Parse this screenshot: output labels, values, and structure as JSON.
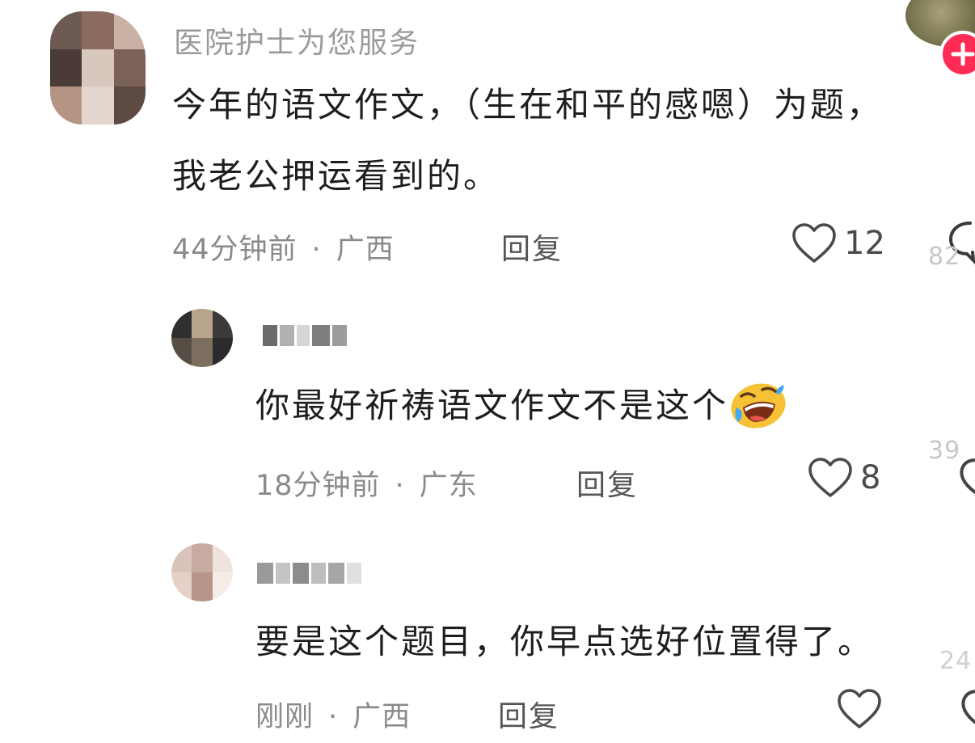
{
  "comments": [
    {
      "username": "医院护士为您服务",
      "lines": [
        "今年的语文作文，（生在和平的感嗯）为题，",
        "我老公押运看到的。"
      ],
      "time": "44分钟前",
      "separator": "·",
      "region": "广西",
      "reply_label": "回复",
      "likes": "12",
      "avatar_colors": [
        "#6d5a52",
        "#8b6b5e",
        "#c9b1a5",
        "#4a3b36",
        "#d8c7bd",
        "#7a6257",
        "#b59484",
        "#e2d6ce",
        "#5c4a43"
      ]
    },
    {
      "username": "",
      "text": "你最好祈祷语文作文不是这个",
      "emoji": "rolling-on-floor-laughing-emoji",
      "time": "18分钟前",
      "separator": "·",
      "region": "广东",
      "reply_label": "回复",
      "likes": "8",
      "avatar_colors": [
        "#2f2f2f",
        "#b8a58c",
        "#3a3a3a",
        "#564e45",
        "#7d6f5f",
        "#2b2b2b"
      ]
    },
    {
      "username": "",
      "text": "要是这个题目，你早点选好位置得了。",
      "time": "刚刚",
      "separator": "·",
      "region": "广西",
      "reply_label": "回复",
      "likes": "",
      "avatar_colors": [
        "#d9c4bc",
        "#c7aaa0",
        "#f0e2dc",
        "#e6d0c7",
        "#b99489",
        "#f6ece7"
      ]
    }
  ],
  "right_edge": {
    "add_icon": "plus-icon",
    "add_color": "#fe2c55",
    "partial_counts": [
      "82",
      "39",
      "24"
    ]
  },
  "colors": {
    "text": "#1e1e1e",
    "muted": "#8a8a8a",
    "username": "#9a9a9a"
  }
}
